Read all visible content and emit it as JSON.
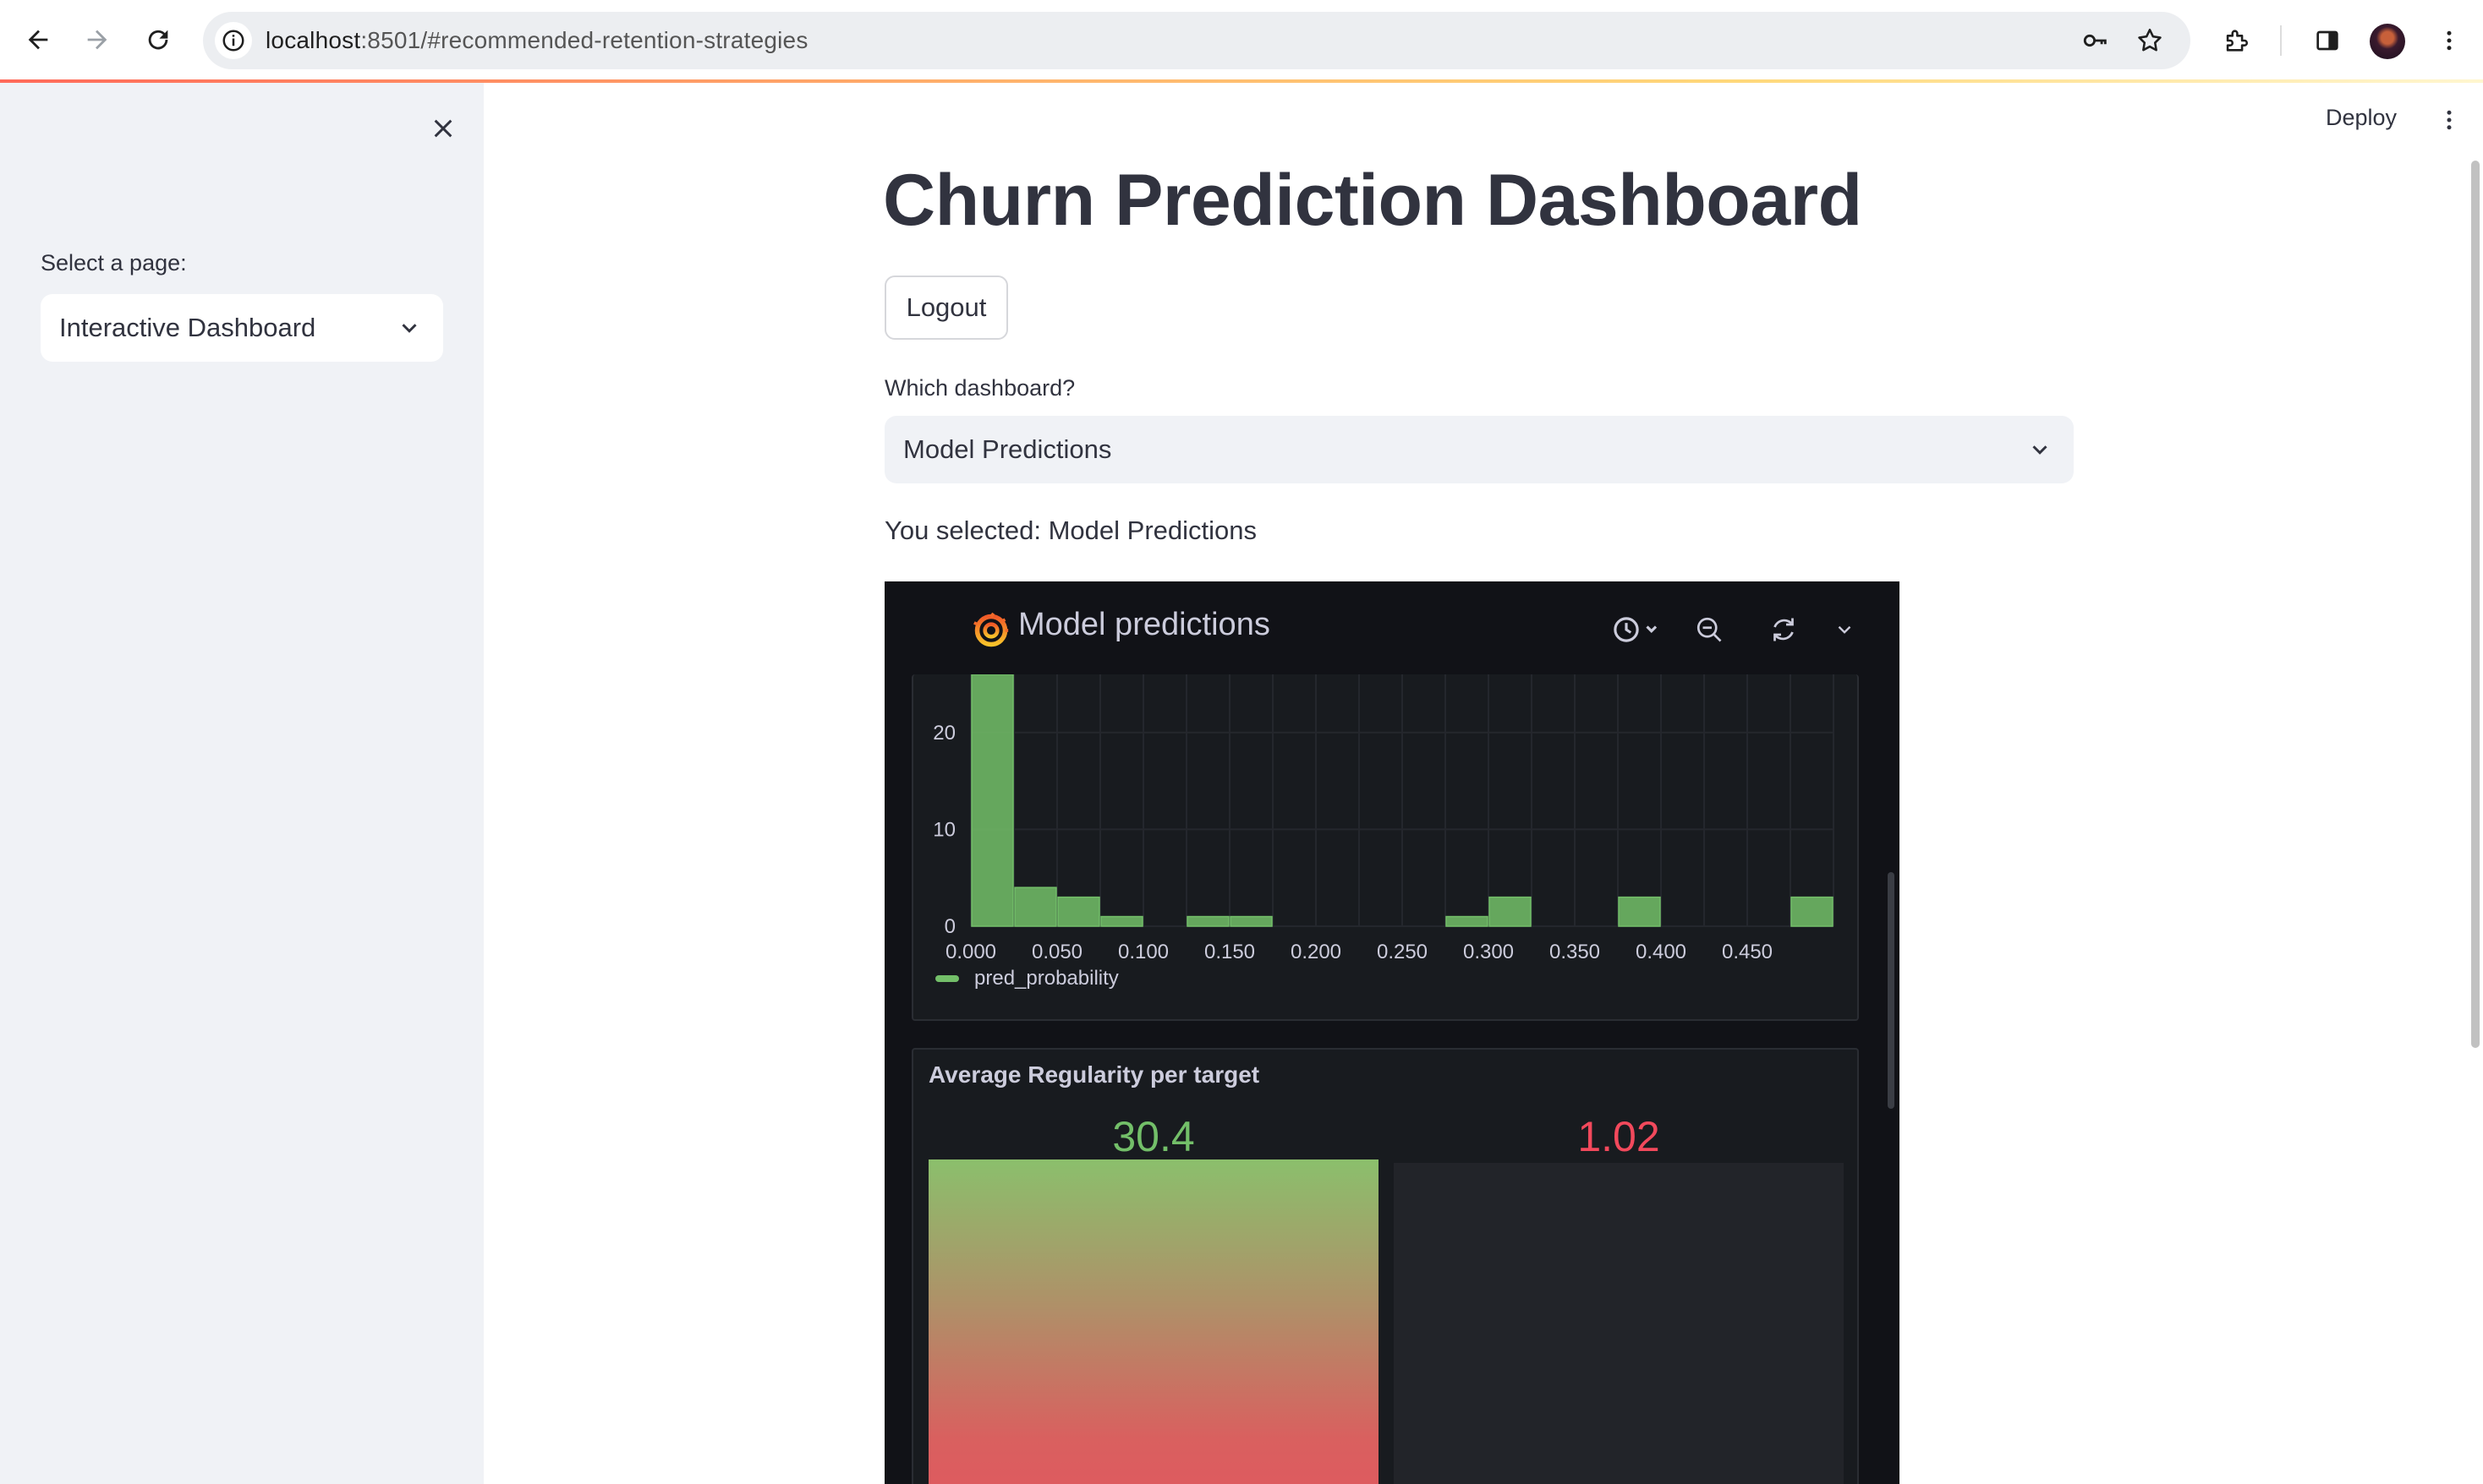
{
  "browser": {
    "url_host": "localhost",
    "url_rest": ":8501/#recommended-retention-strategies",
    "icons": [
      "back-arrow-icon",
      "forward-arrow-icon",
      "reload-icon",
      "site-info-icon",
      "key-icon",
      "star-icon",
      "extensions-icon",
      "side-panel-icon",
      "avatar",
      "menu-kebab-icon"
    ]
  },
  "sidebar": {
    "select_label": "Select a page:",
    "select_value": "Interactive Dashboard"
  },
  "header": {
    "deploy_label": "Deploy"
  },
  "main": {
    "title": "Churn Prediction Dashboard",
    "logout_label": "Logout",
    "dashboard_label": "Which dashboard?",
    "dashboard_value": "Model Predictions",
    "selected_text": "You selected: Model Predictions"
  },
  "grafana": {
    "dashboard_title": "Model predictions",
    "histogram": {
      "legend": "pred_probability",
      "series_color": "#73bf69"
    },
    "bar_panel": {
      "title": "Average Regularity per target",
      "value_1": "30.4",
      "value_1_color": "#73bf69",
      "value_2": "1.02",
      "value_2_color": "#f2495c"
    }
  },
  "chart_data": {
    "type": "bar",
    "subtype": "histogram",
    "x_tick_labels": [
      "0.000",
      "0.050",
      "0.100",
      "0.150",
      "0.200",
      "0.250",
      "0.300",
      "0.350",
      "0.400",
      "0.450"
    ],
    "y_tick_labels": [
      "0",
      "10",
      "20"
    ],
    "bin_width": 0.025,
    "bins_start": [
      0.0,
      0.025,
      0.05,
      0.075,
      0.125,
      0.15,
      0.275,
      0.3,
      0.375,
      0.475
    ],
    "values": [
      26,
      4,
      3,
      1,
      1,
      1,
      1,
      3,
      3,
      3
    ],
    "xlim": [
      0.0,
      0.5
    ],
    "ylim": [
      0,
      26
    ],
    "series": [
      {
        "name": "pred_probability"
      }
    ],
    "grid": true,
    "legend_position": "bottom-left"
  }
}
